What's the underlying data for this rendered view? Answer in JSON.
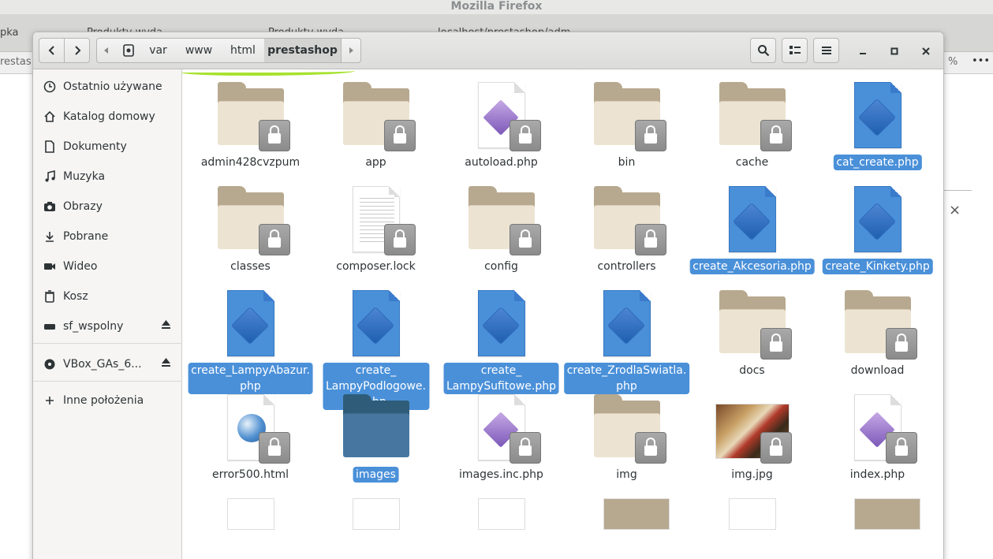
{
  "firefox": {
    "title": "Mozilla Firefox",
    "tab_fragments": [
      "pka",
      "Produkty wyda",
      "Produkty wyda",
      "localhost/prestashop/adm"
    ],
    "url_fragment": "restas",
    "zoom_fragment": "%",
    "menu_glyph": "•••",
    "dialog_close": "×"
  },
  "window": {
    "breadcrumb": [
      "var",
      "www",
      "html",
      "prestashop"
    ],
    "icons": {
      "back": "chevron-left-icon",
      "forward": "chevron-right-icon",
      "search": "search-icon",
      "view": "list-view-icon",
      "menu": "hamburger-icon"
    }
  },
  "sidebar": {
    "items": [
      {
        "label": "Ostatnio używane",
        "icon": "clock-icon"
      },
      {
        "label": "Katalog domowy",
        "icon": "home-icon"
      },
      {
        "label": "Dokumenty",
        "icon": "document-icon"
      },
      {
        "label": "Muzyka",
        "icon": "music-icon"
      },
      {
        "label": "Obrazy",
        "icon": "camera-icon"
      },
      {
        "label": "Pobrane",
        "icon": "download-icon"
      },
      {
        "label": "Wideo",
        "icon": "video-icon"
      },
      {
        "label": "Kosz",
        "icon": "trash-icon"
      },
      {
        "label": "sf_wspolny",
        "icon": "drive-icon"
      },
      {
        "label": "VBox_GAs_6...",
        "icon": "disc-icon"
      },
      {
        "label": "Inne położenia",
        "icon": "plus-icon"
      }
    ]
  },
  "files": [
    {
      "name": "admin428cvzpum",
      "type": "folder",
      "locked": true,
      "selected": false
    },
    {
      "name": "app",
      "type": "folder",
      "locked": true,
      "selected": false
    },
    {
      "name": "autoload.php",
      "type": "php",
      "locked": true,
      "selected": false
    },
    {
      "name": "bin",
      "type": "folder",
      "locked": true,
      "selected": false
    },
    {
      "name": "cache",
      "type": "folder",
      "locked": true,
      "selected": false
    },
    {
      "name": "cat_create.php",
      "type": "php",
      "locked": false,
      "selected": true
    },
    {
      "name": "classes",
      "type": "folder",
      "locked": true,
      "selected": false
    },
    {
      "name": "composer.lock",
      "type": "text",
      "locked": true,
      "selected": false
    },
    {
      "name": "config",
      "type": "folder",
      "locked": true,
      "selected": false
    },
    {
      "name": "controllers",
      "type": "folder",
      "locked": true,
      "selected": false
    },
    {
      "name": "create_Akcesoria.php",
      "type": "php",
      "locked": false,
      "selected": true
    },
    {
      "name": "create_Kinkety.php",
      "type": "php",
      "locked": false,
      "selected": true
    },
    {
      "name": "create_LampyAbazur.\nphp",
      "type": "php",
      "locked": false,
      "selected": true
    },
    {
      "name": "create_\nLampyPodlogowe.\nphp",
      "type": "php",
      "locked": false,
      "selected": true
    },
    {
      "name": "create_\nLampySufitowe.php",
      "type": "php",
      "locked": false,
      "selected": true
    },
    {
      "name": "create_ZrodlaSwiatla.\nphp",
      "type": "php",
      "locked": false,
      "selected": true
    },
    {
      "name": "docs",
      "type": "folder",
      "locked": true,
      "selected": false
    },
    {
      "name": "download",
      "type": "folder",
      "locked": true,
      "selected": false
    },
    {
      "name": "error500.html",
      "type": "html",
      "locked": true,
      "selected": false
    },
    {
      "name": "images",
      "type": "folder",
      "locked": false,
      "selected": true
    },
    {
      "name": "images.inc.php",
      "type": "php",
      "locked": true,
      "selected": false
    },
    {
      "name": "img",
      "type": "folder",
      "locked": true,
      "selected": false
    },
    {
      "name": "img.jpg",
      "type": "image",
      "locked": true,
      "selected": false
    },
    {
      "name": "index.php",
      "type": "php",
      "locked": true,
      "selected": false
    }
  ]
}
